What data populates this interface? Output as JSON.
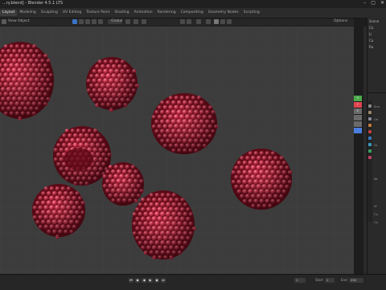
{
  "window": {
    "title": "...ry.blend] - Blender 4.5.1 LTS",
    "controls": [
      "–",
      "▢",
      "✕"
    ]
  },
  "workspace_tabs": [
    {
      "label": "Layout",
      "active": true
    },
    {
      "label": "Modeling",
      "active": false
    },
    {
      "label": "Sculpting",
      "active": false
    },
    {
      "label": "UV Editing",
      "active": false
    },
    {
      "label": "Texture Paint",
      "active": false
    },
    {
      "label": "Shading",
      "active": false
    },
    {
      "label": "Animation",
      "active": false
    },
    {
      "label": "Rendering",
      "active": false
    },
    {
      "label": "Compositing",
      "active": false
    },
    {
      "label": "Geometry Nodes",
      "active": false
    },
    {
      "label": "Scripting",
      "active": false
    }
  ],
  "scene_field": "Scene",
  "viewport_header": {
    "view_label": "View",
    "object_label": "Object",
    "transform_orientation": "Global",
    "options_label": "Options"
  },
  "outliner": {
    "rows": [
      "Scene",
      "Co",
      "Li",
      "Ca",
      "Ra"
    ]
  },
  "properties": {
    "rows": [
      "Sca",
      "Un",
      "Gr",
      "Ke",
      "Vi",
      "Cu",
      "Co"
    ]
  },
  "navigation_gizmo": {
    "labels": [
      "X",
      "Y",
      "Z",
      "",
      "",
      "",
      ""
    ]
  },
  "timeline": {
    "start_label": "Start",
    "start_value": "1",
    "end_label": "End",
    "end_value": "250",
    "current_frame": "1"
  },
  "colors": {
    "raspberry": "#d8344c",
    "raspberry_dark": "#7a0d1e",
    "viewport_bg": "#3c3c3c"
  }
}
